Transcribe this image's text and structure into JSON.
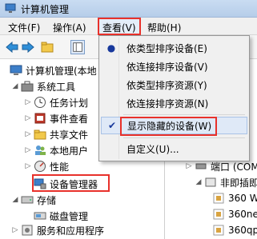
{
  "window": {
    "title": "计算机管理"
  },
  "menubar": {
    "items": [
      {
        "label": "文件(F)"
      },
      {
        "label": "操作(A)"
      },
      {
        "label": "查看(V)"
      },
      {
        "label": "帮助(H)"
      }
    ]
  },
  "view_menu": {
    "items": [
      {
        "label": "依类型排序设备(E)",
        "mark": "●"
      },
      {
        "label": "依连接排序设备(V)",
        "mark": ""
      },
      {
        "label": "依类型排序资源(Y)",
        "mark": ""
      },
      {
        "label": "依连接排序资源(N)",
        "mark": ""
      },
      {
        "label": "显示隐藏的设备(W)",
        "mark": "✔"
      },
      {
        "label": "自定义(U)...",
        "mark": ""
      }
    ]
  },
  "tree": {
    "root": "计算机管理(本地",
    "system_tools": "系统工具",
    "task_scheduler": "任务计划",
    "event_viewer": "事件查看",
    "shared_folders": "共享文件",
    "local_users": "本地用户",
    "performance": "性能",
    "device_manager": "设备管理器",
    "storage": "存储",
    "disk_mgmt": "磁盘管理",
    "services_apps": "服务和应用程序"
  },
  "right_pane": {
    "ports": "端口 (COM",
    "non_pnp": "非即插即用",
    "items": [
      "360 W",
      "360net",
      "360qp"
    ]
  },
  "colors": {
    "highlight_red": "#e8312b",
    "accent_blue": "#17389c"
  }
}
